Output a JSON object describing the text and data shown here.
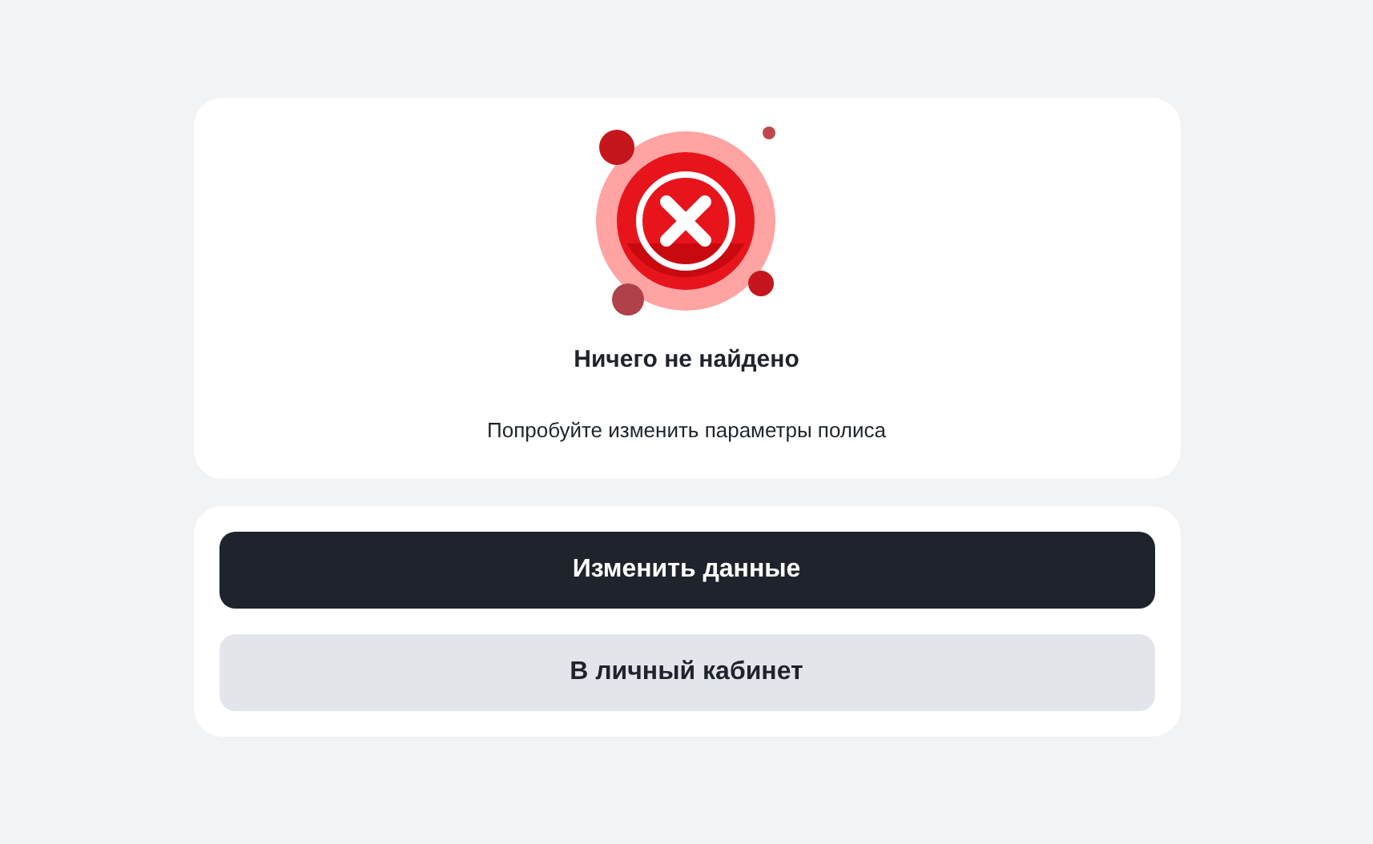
{
  "result": {
    "title": "Ничего не найдено",
    "message": "Попробуйте изменить параметры полиса"
  },
  "actions": [
    {
      "label": "Изменить данные",
      "kind": "primary"
    },
    {
      "label": "В личный кабинет",
      "kind": "secondary"
    }
  ]
}
